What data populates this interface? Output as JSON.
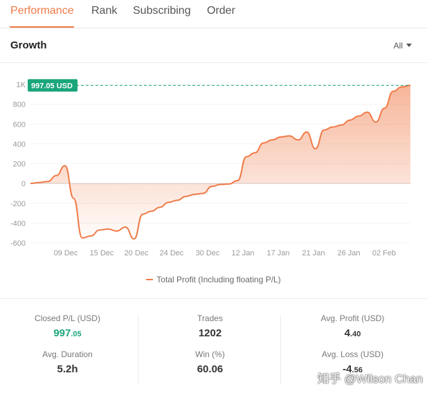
{
  "tabs": [
    {
      "label": "Performance",
      "active": true
    },
    {
      "label": "Rank",
      "active": false
    },
    {
      "label": "Subscribing",
      "active": false
    },
    {
      "label": "Order",
      "active": false
    }
  ],
  "header": {
    "title": "Growth",
    "filter_label": "All"
  },
  "colors": {
    "accent": "#f07a47",
    "green": "#1aa57b"
  },
  "chart_data": {
    "type": "area",
    "ylim": [
      -600,
      1000
    ],
    "yticks": [
      "1K",
      "800",
      "600",
      "400",
      "200",
      "0",
      "-200",
      "-400",
      "-600"
    ],
    "xticks": [
      "09 Dec",
      "15 Dec",
      "20 Dec",
      "24 Dec",
      "30 Dec",
      "12 Jan",
      "17 Jan",
      "21 Jan",
      "26 Jan",
      "02 Feb"
    ],
    "series": [
      {
        "name": "Total Profit (Including floating P/L)",
        "values": [
          0,
          10,
          20,
          80,
          180,
          -150,
          -550,
          -530,
          -470,
          -460,
          -480,
          -440,
          -560,
          -310,
          -280,
          -240,
          -190,
          -170,
          -130,
          -110,
          -100,
          -30,
          -10,
          -5,
          30,
          270,
          310,
          410,
          440,
          470,
          480,
          440,
          520,
          350,
          540,
          570,
          590,
          640,
          680,
          720,
          620,
          760,
          930,
          975,
          990
        ]
      }
    ],
    "max_label": "997.05 USD",
    "legend": "bottom"
  },
  "stats": {
    "closed_pl_label": "Closed P/L (USD)",
    "closed_pl_int": "997",
    "closed_pl_dec": ".05",
    "trades_label": "Trades",
    "trades_value": "1202",
    "avg_profit_label": "Avg. Profit (USD)",
    "avg_profit_int": "4",
    "avg_profit_dec": ".40",
    "avg_duration_label": "Avg. Duration",
    "avg_duration_value": "5.2h",
    "win_label": "Win (%)",
    "win_value": "60.06",
    "avg_loss_label": "Avg. Loss (USD)",
    "avg_loss_int": "-4",
    "avg_loss_dec": ".56"
  },
  "watermark": "知乎 @Wilson Chan"
}
